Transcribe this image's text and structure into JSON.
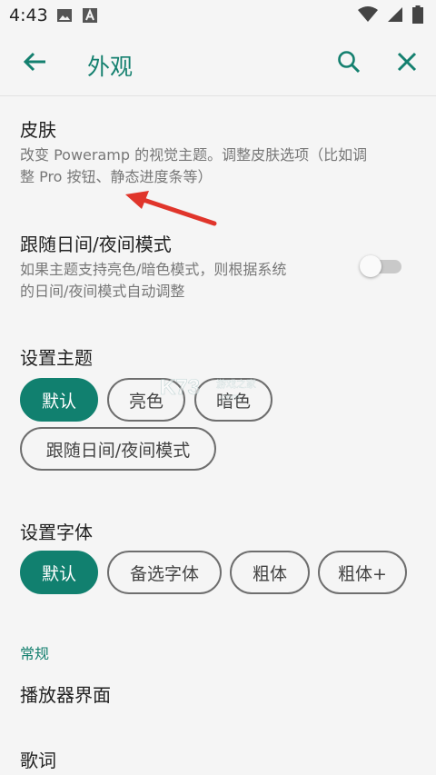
{
  "status_bar": {
    "time": "4:43",
    "icons_left": [
      "image-icon",
      "a-box-icon"
    ],
    "icons_right": [
      "wifi-icon",
      "signal-icon",
      "battery-icon"
    ]
  },
  "app_bar": {
    "title": "外观",
    "back_icon": "arrow-left-icon",
    "search_icon": "search-icon",
    "close_icon": "close-icon",
    "accent_color": "#14806f"
  },
  "settings": {
    "skin": {
      "title": "皮肤",
      "subtitle_line1": "改变 Poweramp 的视觉主题。调整皮肤选项（比如调",
      "subtitle_line2": "整 Pro 按钮、静态进度条等）"
    },
    "follow_day_night": {
      "title": "跟随日间/夜间模式",
      "subtitle_line1": "如果主题支持亮色/暗色模式，则根据系统",
      "subtitle_line2": "的日间/夜间模式自动调整",
      "enabled": false
    }
  },
  "theme": {
    "label": "设置主题",
    "options": [
      "默认",
      "亮色",
      "暗色",
      "跟随日间/夜间模式"
    ],
    "selected": "默认"
  },
  "font": {
    "label": "设置字体",
    "options": [
      "默认",
      "备选字体",
      "粗体",
      "粗体+"
    ],
    "selected": "默认"
  },
  "general": {
    "category": "常规",
    "items": [
      "播放器界面",
      "歌词"
    ]
  },
  "watermark": {
    "logo": "K73",
    "text": "游戏之家",
    "domain": ".com"
  },
  "colors": {
    "accent": "#11806f",
    "annotation_arrow": "#e0352b"
  }
}
